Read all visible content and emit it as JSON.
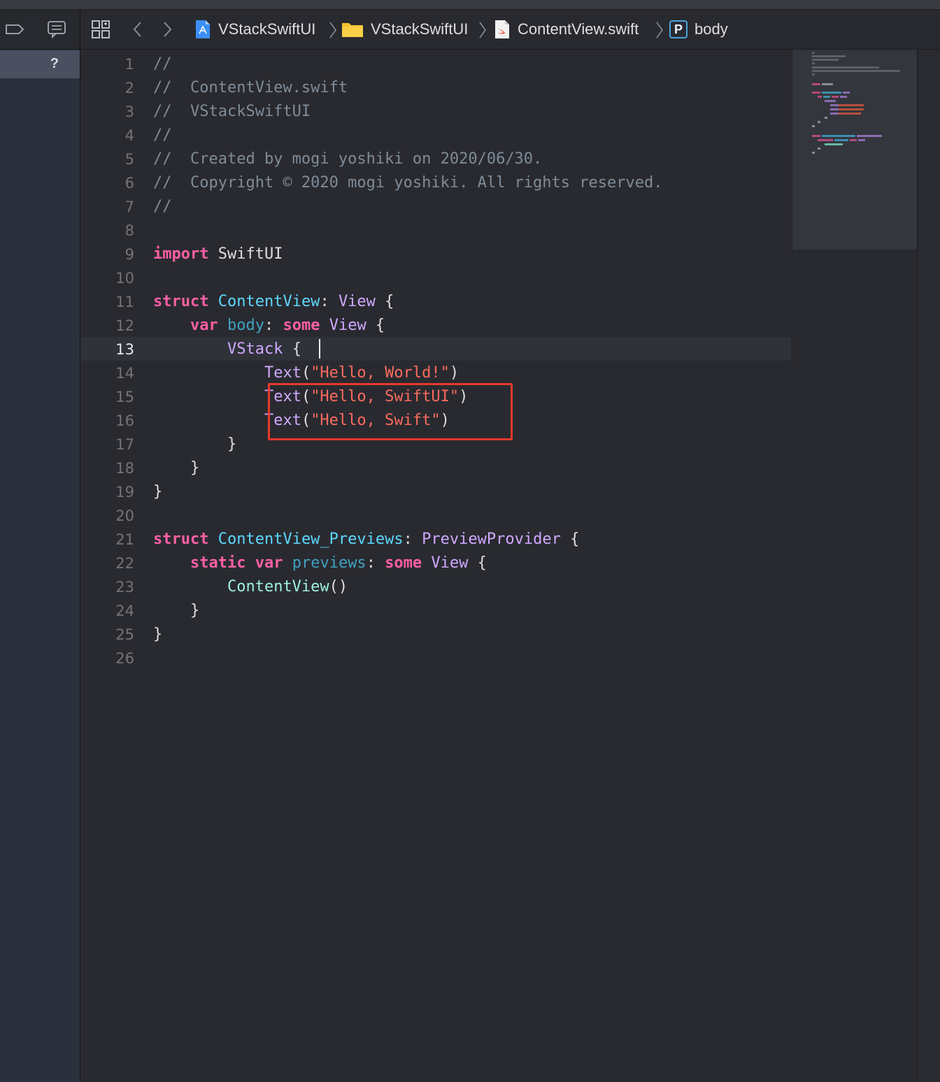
{
  "jumpbar": {
    "crumbs": [
      {
        "label": "VStackSwiftUI",
        "icon": "xcode-project-icon"
      },
      {
        "label": "VStackSwiftUI",
        "icon": "folder-icon"
      },
      {
        "label": "ContentView.swift",
        "icon": "swift-file-icon"
      },
      {
        "label": "body",
        "icon": "property-icon",
        "badge": "P"
      }
    ]
  },
  "navigator": {
    "help_label": "?"
  },
  "editor": {
    "current_line": 13,
    "line_numbers": [
      "1",
      "2",
      "3",
      "4",
      "5",
      "6",
      "7",
      "8",
      "9",
      "10",
      "11",
      "12",
      "13",
      "14",
      "15",
      "16",
      "17",
      "18",
      "19",
      "20",
      "21",
      "22",
      "23",
      "24",
      "25",
      "26"
    ],
    "lines": [
      [
        {
          "t": "//",
          "c": "comment"
        }
      ],
      [
        {
          "t": "//  ContentView.swift",
          "c": "comment"
        }
      ],
      [
        {
          "t": "//  VStackSwiftUI",
          "c": "comment"
        }
      ],
      [
        {
          "t": "//",
          "c": "comment"
        }
      ],
      [
        {
          "t": "//  Created by mogi yoshiki on 2020/06/30.",
          "c": "comment"
        }
      ],
      [
        {
          "t": "//  Copyright © 2020 mogi yoshiki. All rights reserved.",
          "c": "comment"
        }
      ],
      [
        {
          "t": "//",
          "c": "comment"
        }
      ],
      [],
      [
        {
          "t": "import",
          "c": "kw"
        },
        {
          "t": " SwiftUI",
          "c": "plain"
        }
      ],
      [],
      [
        {
          "t": "struct",
          "c": "kw"
        },
        {
          "t": " ",
          "c": "plain"
        },
        {
          "t": "ContentView",
          "c": "typedecl"
        },
        {
          "t": ": ",
          "c": "plain"
        },
        {
          "t": "View",
          "c": "type"
        },
        {
          "t": " {",
          "c": "plain"
        }
      ],
      [
        {
          "t": "    ",
          "c": "plain"
        },
        {
          "t": "var",
          "c": "kw"
        },
        {
          "t": " ",
          "c": "plain"
        },
        {
          "t": "body",
          "c": "var"
        },
        {
          "t": ": ",
          "c": "plain"
        },
        {
          "t": "some",
          "c": "kw"
        },
        {
          "t": " ",
          "c": "plain"
        },
        {
          "t": "View",
          "c": "type"
        },
        {
          "t": " {",
          "c": "plain"
        }
      ],
      [
        {
          "t": "        ",
          "c": "plain"
        },
        {
          "t": "VStack",
          "c": "text"
        },
        {
          "t": " {",
          "c": "plain"
        }
      ],
      [
        {
          "t": "            ",
          "c": "plain"
        },
        {
          "t": "Text",
          "c": "text"
        },
        {
          "t": "(",
          "c": "plain"
        },
        {
          "t": "\"Hello, World!\"",
          "c": "str"
        },
        {
          "t": ")",
          "c": "plain"
        }
      ],
      [
        {
          "t": "            ",
          "c": "plain"
        },
        {
          "t": "Text",
          "c": "text"
        },
        {
          "t": "(",
          "c": "plain"
        },
        {
          "t": "\"Hello, SwiftUI\"",
          "c": "str"
        },
        {
          "t": ")",
          "c": "plain"
        }
      ],
      [
        {
          "t": "            ",
          "c": "plain"
        },
        {
          "t": "Text",
          "c": "text"
        },
        {
          "t": "(",
          "c": "plain"
        },
        {
          "t": "\"Hello, Swift\"",
          "c": "str"
        },
        {
          "t": ")",
          "c": "plain"
        }
      ],
      [
        {
          "t": "        }",
          "c": "plain"
        }
      ],
      [
        {
          "t": "    }",
          "c": "plain"
        }
      ],
      [
        {
          "t": "}",
          "c": "plain"
        }
      ],
      [],
      [
        {
          "t": "struct",
          "c": "kw"
        },
        {
          "t": " ",
          "c": "plain"
        },
        {
          "t": "ContentView_Previews",
          "c": "typedecl"
        },
        {
          "t": ": ",
          "c": "plain"
        },
        {
          "t": "PreviewProvider",
          "c": "type"
        },
        {
          "t": " {",
          "c": "plain"
        }
      ],
      [
        {
          "t": "    ",
          "c": "plain"
        },
        {
          "t": "static",
          "c": "kw"
        },
        {
          "t": " ",
          "c": "plain"
        },
        {
          "t": "var",
          "c": "kw"
        },
        {
          "t": " ",
          "c": "plain"
        },
        {
          "t": "previews",
          "c": "var"
        },
        {
          "t": ": ",
          "c": "plain"
        },
        {
          "t": "some",
          "c": "kw"
        },
        {
          "t": " ",
          "c": "plain"
        },
        {
          "t": "View",
          "c": "type"
        },
        {
          "t": " {",
          "c": "plain"
        }
      ],
      [
        {
          "t": "        ",
          "c": "plain"
        },
        {
          "t": "ContentView",
          "c": "cview"
        },
        {
          "t": "()",
          "c": "plain"
        }
      ],
      [
        {
          "t": "    }",
          "c": "plain"
        }
      ],
      [
        {
          "t": "}",
          "c": "plain"
        }
      ],
      []
    ]
  },
  "colors": {
    "keyword": "#fc5fa3",
    "string": "#fc6a5d",
    "comment": "#7f8c98",
    "type_decl": "#5dd8ff",
    "type": "#d0a8ff",
    "variable": "#41a1c0",
    "highlight_box": "#e8382c",
    "editor_bg": "#292a30"
  }
}
